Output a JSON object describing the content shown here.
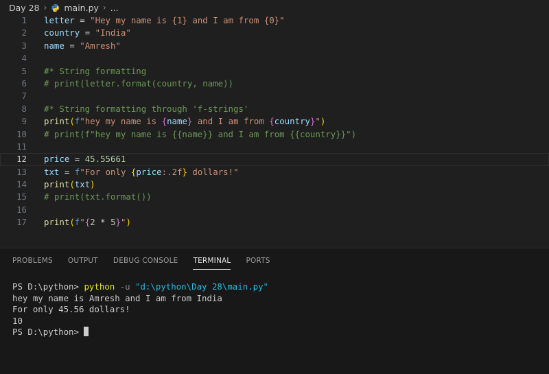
{
  "breadcrumb": {
    "folder": "Day 28",
    "file": "main.py",
    "more": "..."
  },
  "editor": {
    "current_line": 12,
    "lines": [
      {
        "n": "1",
        "text": "letter = \"Hey my name is {1} and I am from {0}\""
      },
      {
        "n": "2",
        "text": "country = \"India\""
      },
      {
        "n": "3",
        "text": "name = \"Amresh\""
      },
      {
        "n": "4",
        "text": ""
      },
      {
        "n": "5",
        "text": "#* String formatting"
      },
      {
        "n": "6",
        "text": "# print(letter.format(country, name))"
      },
      {
        "n": "7",
        "text": ""
      },
      {
        "n": "8",
        "text": "#* String formatting through 'f-strings'"
      },
      {
        "n": "9",
        "text": "print(f\"hey my name is {name} and I am from {country}\")"
      },
      {
        "n": "10",
        "text": "# print(f\"hey my name is {{name}} and I am from {{country}}\")"
      },
      {
        "n": "11",
        "text": ""
      },
      {
        "n": "12",
        "text": "price = 45.55661"
      },
      {
        "n": "13",
        "text": "txt = f\"For only {price:.2f} dollars!\""
      },
      {
        "n": "14",
        "text": "print(txt)"
      },
      {
        "n": "15",
        "text": "# print(txt.format())"
      },
      {
        "n": "16",
        "text": ""
      },
      {
        "n": "17",
        "text": "print(f\"{2 * 5}\")"
      }
    ]
  },
  "panel": {
    "tabs": [
      {
        "label": "PROBLEMS"
      },
      {
        "label": "OUTPUT"
      },
      {
        "label": "DEBUG CONSOLE"
      },
      {
        "label": "TERMINAL",
        "active": true
      },
      {
        "label": "PORTS"
      }
    ],
    "terminal": {
      "prompt": "PS D:\\python> ",
      "command": "python",
      "flag": " -u ",
      "path": "\"d:\\python\\Day 28\\main.py\"",
      "output": [
        "hey my name is Amresh and I am from India",
        "For only 45.56 dollars!",
        "10"
      ],
      "final_prompt": "PS D:\\python> "
    }
  },
  "colors": {
    "editor_bg": "#1f1f1f",
    "panel_bg": "#181818",
    "string": "#ce9178",
    "variable": "#9cdcfe",
    "comment": "#6a9955",
    "function": "#dcdcaa",
    "number": "#b5cea8",
    "terminal_command": "#e5e510",
    "terminal_path": "#29b8db"
  },
  "icons": {
    "file_icon": "python-icon",
    "chevron": "chevron-right-icon"
  }
}
